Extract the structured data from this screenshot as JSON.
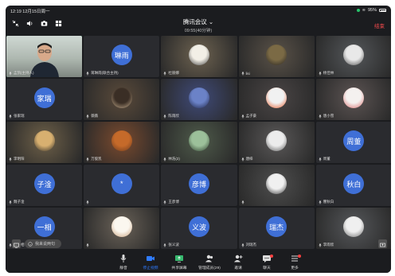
{
  "status_bar": {
    "time": "12:19  12月15日周一",
    "battery": "95%"
  },
  "header": {
    "title": "腾讯会议 ⌄",
    "subtitle": "09:55(40分钟)",
    "end": "结束"
  },
  "tiles": [
    {
      "type": "selfie",
      "label": "孟凯(主持人)",
      "active": true
    },
    {
      "type": "circle",
      "initials": "琳雨",
      "label": "蒋琳雨(联合主持)"
    },
    {
      "type": "photo",
      "bg": "#6d6250",
      "av": [
        "#f2efe6",
        "#3b3a3a"
      ],
      "label": "杜丽娜"
    },
    {
      "type": "photo",
      "bg": "#5a5248",
      "av": [
        "#7b6a45",
        "#252321"
      ],
      "label": "lisi"
    },
    {
      "type": "photo",
      "bg": "#54575a",
      "av": [
        "#e8e8e8",
        "#4a4a4a"
      ],
      "label": "杨佳林"
    },
    {
      "type": "circle",
      "initials": "家瑞",
      "label": "张家瑞"
    },
    {
      "type": "photo",
      "bg": "#5a4a3a",
      "av": [
        "#3a2e25",
        "#c8b090"
      ],
      "label": "薇薇"
    },
    {
      "type": "photo",
      "bg": "#3f4a78",
      "av": [
        "#6b82c7",
        "#1e2446"
      ],
      "label": "陈雨欣"
    },
    {
      "type": "photo",
      "bg": "#4a4545",
      "av": [
        "#f1f1f1",
        "#e65a2a"
      ],
      "label": "孟子豪"
    },
    {
      "type": "photo",
      "bg": "#5c5453",
      "av": [
        "#f4f1ef",
        "#d86b6b"
      ],
      "label": "唐小雪"
    },
    {
      "type": "photo",
      "bg": "#6e6048",
      "av": [
        "#d8b070",
        "#2e2a26"
      ],
      "label": "李明阳"
    },
    {
      "type": "photo",
      "bg": "#7a4a2e",
      "av": [
        "#c56a2a",
        "#6b3a1e"
      ],
      "label": "万俊凯"
    },
    {
      "type": "photo",
      "bg": "#4e5a4a",
      "av": [
        "#9cc09a",
        "#2a3a2a"
      ],
      "label": "林浩(2)"
    },
    {
      "type": "photo",
      "bg": "#5a5858",
      "av": [
        "#ececec",
        "#555"
      ],
      "label": "唐梓"
    },
    {
      "type": "circle",
      "initials": "周董",
      "label": "周董"
    },
    {
      "type": "circle",
      "initials": "子淦",
      "label": "魏子淦"
    },
    {
      "type": "circle",
      "initials": "*",
      "label": ""
    },
    {
      "type": "circle",
      "initials": "彦博",
      "label": "王彦博"
    },
    {
      "type": "photo",
      "bg": "#4e4e4e",
      "av": [
        "#f0f0f0",
        "#333"
      ],
      "label": ""
    },
    {
      "type": "circle",
      "initials": "秋白",
      "label": "瞿秋白"
    },
    {
      "type": "circle",
      "initials": "一相",
      "label": "李一相"
    },
    {
      "type": "photo",
      "bg": "#6a6258",
      "av": [
        "#fbf7ef",
        "#c9a07a"
      ],
      "label": ""
    },
    {
      "type": "circle",
      "initials": "义波",
      "label": "张义波"
    },
    {
      "type": "circle",
      "initials": "瑞杰",
      "label": "刘瑞杰"
    },
    {
      "type": "photo",
      "bg": "#55575a",
      "av": [
        "#efefef",
        "#6a6a6a"
      ],
      "label": "李雨欣"
    }
  ],
  "message_placeholder": "我来说两句",
  "toolbar": [
    {
      "id": "mute",
      "label": "静音",
      "icon": "mic-icon"
    },
    {
      "id": "video",
      "label": "停止视频",
      "icon": "video-icon",
      "color": "#2f7bff"
    },
    {
      "id": "share",
      "label": "共享屏幕",
      "icon": "share-screen-icon"
    },
    {
      "id": "members",
      "label": "管理成员(29)",
      "icon": "members-icon"
    },
    {
      "id": "invite",
      "label": "邀请",
      "icon": "invite-icon"
    },
    {
      "id": "chat",
      "label": "聊天",
      "icon": "chat-icon"
    },
    {
      "id": "more",
      "label": "更多",
      "icon": "more-icon"
    }
  ],
  "colors": {
    "accent": "#2f7bff",
    "active_border": "#2bd17e",
    "end": "#ff4d4f",
    "avatar": "#3f6fd6"
  }
}
